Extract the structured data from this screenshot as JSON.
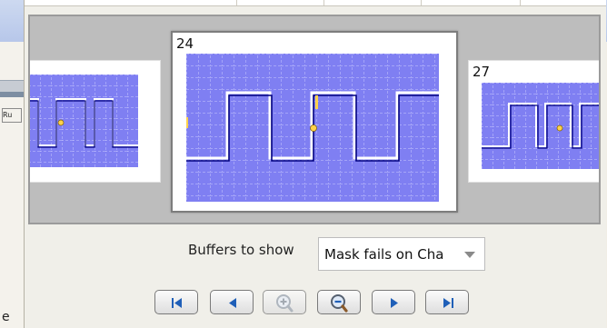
{
  "background": {
    "run_button_label": "Ru",
    "partial_text": "e"
  },
  "frames": [
    {
      "number": "",
      "selected": false
    },
    {
      "number": "24",
      "selected": true
    },
    {
      "number": "27",
      "selected": false
    }
  ],
  "buffers_to_show": {
    "label": "Buffers to show",
    "selected_value": "Mask fails on Cha"
  },
  "navigation": [
    {
      "name": "first-buffer-button",
      "icon": "skip-to-first-icon"
    },
    {
      "name": "previous-buffer-button",
      "icon": "previous-icon"
    },
    {
      "name": "zoom-in-button",
      "icon": "zoom-in-icon"
    },
    {
      "name": "zoom-out-button",
      "icon": "zoom-out-icon"
    },
    {
      "name": "next-buffer-button",
      "icon": "next-icon"
    },
    {
      "name": "last-buffer-button",
      "icon": "skip-to-last-icon"
    }
  ],
  "colors": {
    "scope_background": "#7f7ff2",
    "trace": "#000080",
    "trace_highlight": "#ffffff",
    "marker": "#ffd24a"
  }
}
